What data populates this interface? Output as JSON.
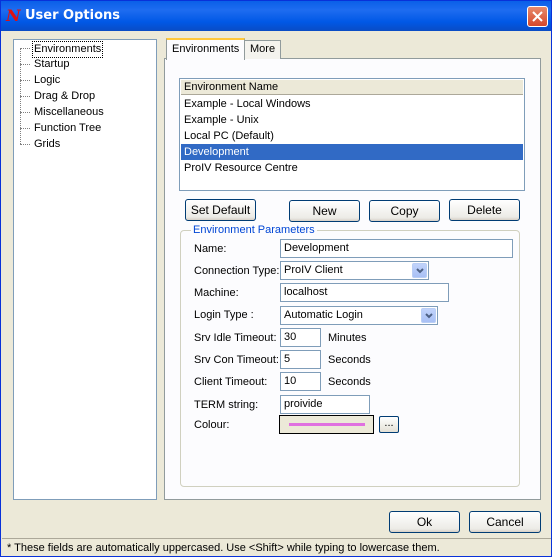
{
  "window": {
    "title": "User Options",
    "icon": "proiv-icon",
    "close_icon": "close-icon"
  },
  "tree": {
    "items": [
      {
        "label": "Environments",
        "selected": true
      },
      {
        "label": "Startup"
      },
      {
        "label": "Logic"
      },
      {
        "label": "Drag & Drop"
      },
      {
        "label": "Miscellaneous"
      },
      {
        "label": "Function Tree"
      },
      {
        "label": "Grids"
      }
    ]
  },
  "tabs": [
    {
      "label": "Environments",
      "active": true
    },
    {
      "label": "More",
      "active": false
    }
  ],
  "environments": {
    "column_header": "Environment Name",
    "rows": [
      {
        "name": "Example - Local Windows"
      },
      {
        "name": "Example - Unix"
      },
      {
        "name": "Local PC (Default)"
      },
      {
        "name": "Development",
        "selected": true
      },
      {
        "name": "ProIV Resource Centre"
      }
    ]
  },
  "buttons": {
    "set_default": "Set Default",
    "new": "New",
    "copy": "Copy",
    "delete": "Delete",
    "ok": "Ok",
    "cancel": "Cancel",
    "colour_picker": "..."
  },
  "params": {
    "group_title": "Environment Parameters",
    "name_label": "Name:",
    "name_value": "Development",
    "connection_type_label": "Connection Type:",
    "connection_type_value": "ProIV Client",
    "machine_label": "Machine:",
    "machine_value": "localhost",
    "login_type_label": "Login Type :",
    "login_type_value": "Automatic Login",
    "srv_idle_label": "Srv Idle Timeout:",
    "srv_idle_value": "30",
    "srv_idle_unit": "Minutes",
    "srv_con_label": "Srv Con Timeout:",
    "srv_con_value": "5",
    "srv_con_unit": "Seconds",
    "client_timeout_label": "Client Timeout:",
    "client_timeout_value": "10",
    "client_timeout_unit": "Seconds",
    "term_label": "TERM string:",
    "term_value": "proivide",
    "colour_label": "Colour:",
    "colour_value": "#E070E0"
  },
  "status_text": "* These fields are automatically uppercased. Use <Shift> while typing to lowercase them."
}
